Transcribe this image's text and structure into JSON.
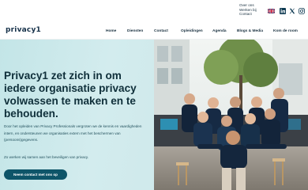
{
  "topbar": {
    "links": [
      "Over ons",
      "Werken bij",
      "Contact"
    ],
    "language_flag": "uk-flag-icon",
    "social": [
      "linkedin-icon",
      "x-icon",
      "instagram-icon"
    ]
  },
  "navbar": {
    "logo_text": "privacy1",
    "items": [
      {
        "label": "Home"
      },
      {
        "label": "Diensten"
      },
      {
        "label": "Contact"
      },
      {
        "label": "Opleidingen"
      },
      {
        "label": "Agenda"
      },
      {
        "label": "Blogs & Media"
      },
      {
        "label": "Kom de room"
      }
    ]
  },
  "hero": {
    "title": "Privacy1 zet zich in om iedere organisatie privacy volwassen te maken en te behouden.",
    "description": "Door het opleiden van Privacy Professionals vergroten we de kennis en vaardigheden intern, en ondersteunen we organisaties extern met het beschermen van (persoons)gegevens.",
    "subtext": "Zo werken wij samen aan het beveiligen van privacy.",
    "cta_label": "Neem contact met ons op"
  },
  "colors": {
    "brand_dark": "#0f2f3a",
    "hero_bg": "#cde9ea",
    "cta_bg": "#0e5569"
  }
}
